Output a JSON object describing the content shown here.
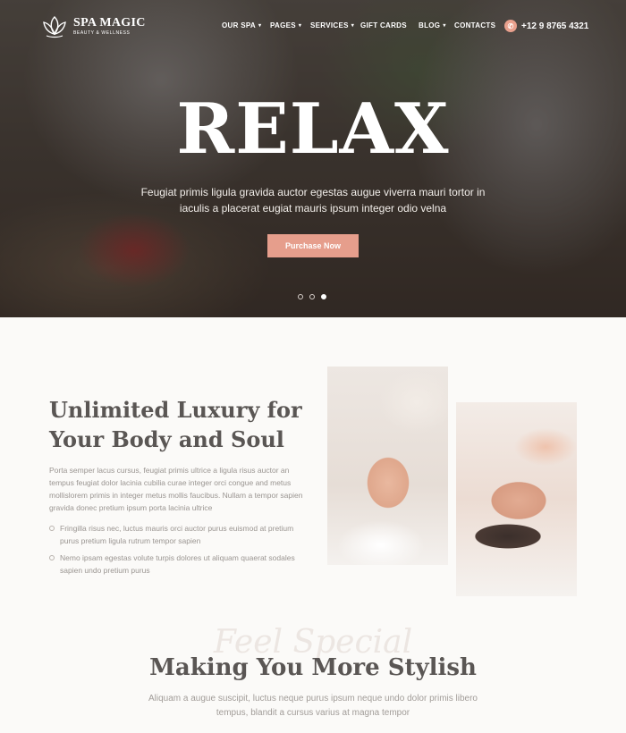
{
  "brand": {
    "name": "SPA MAGIC",
    "tagline": "BEAUTY & WELLNESS",
    "accent": "#e69e8c"
  },
  "nav": {
    "items": [
      {
        "label": "OUR SPA",
        "has_dropdown": true
      },
      {
        "label": "PAGES",
        "has_dropdown": true
      },
      {
        "label": "SERVICES",
        "has_dropdown": true
      },
      {
        "label": "GIFT CARDS",
        "has_dropdown": false
      },
      {
        "label": "BLOG",
        "has_dropdown": true
      },
      {
        "label": "CONTACTS",
        "has_dropdown": false
      }
    ],
    "phone": "+12 9 8765 4321",
    "phone_icon": "phone-icon"
  },
  "hero": {
    "title": "RELAX",
    "subtitle": "Feugiat primis ligula gravida auctor egestas augue viverra mauri tortor in iaculis a placerat eugiat mauris ipsum integer odio velna",
    "button": "Purchase Now",
    "slides": 3,
    "active_slide": 3
  },
  "about": {
    "title": "Unlimited Luxury for Your Body and Soul",
    "text": "Porta semper lacus cursus, feugiat primis ultrice a ligula risus auctor an tempus feugiat dolor lacinia cubilia curae integer orci congue and metus mollislorem primis in integer metus mollis faucibus. Nullam a tempor sapien gravida donec pretium ipsum porta lacinia ultrice",
    "bullets": [
      "Fringilla risus nec, luctus mauris orci auctor purus euismod at pretium purus pretium ligula rutrum tempor sapien",
      "Nemo ipsam egestas volute turpis dolores ut aliquam quaerat sodales sapien undo pretium purus"
    ]
  },
  "stylish": {
    "script": "Feel Special",
    "title": "Making You More Stylish",
    "text": "Aliquam a augue suscipit, luctus neque purus ipsum neque undo dolor primis libero tempus, blandit a cursus varius at magna tempor"
  }
}
